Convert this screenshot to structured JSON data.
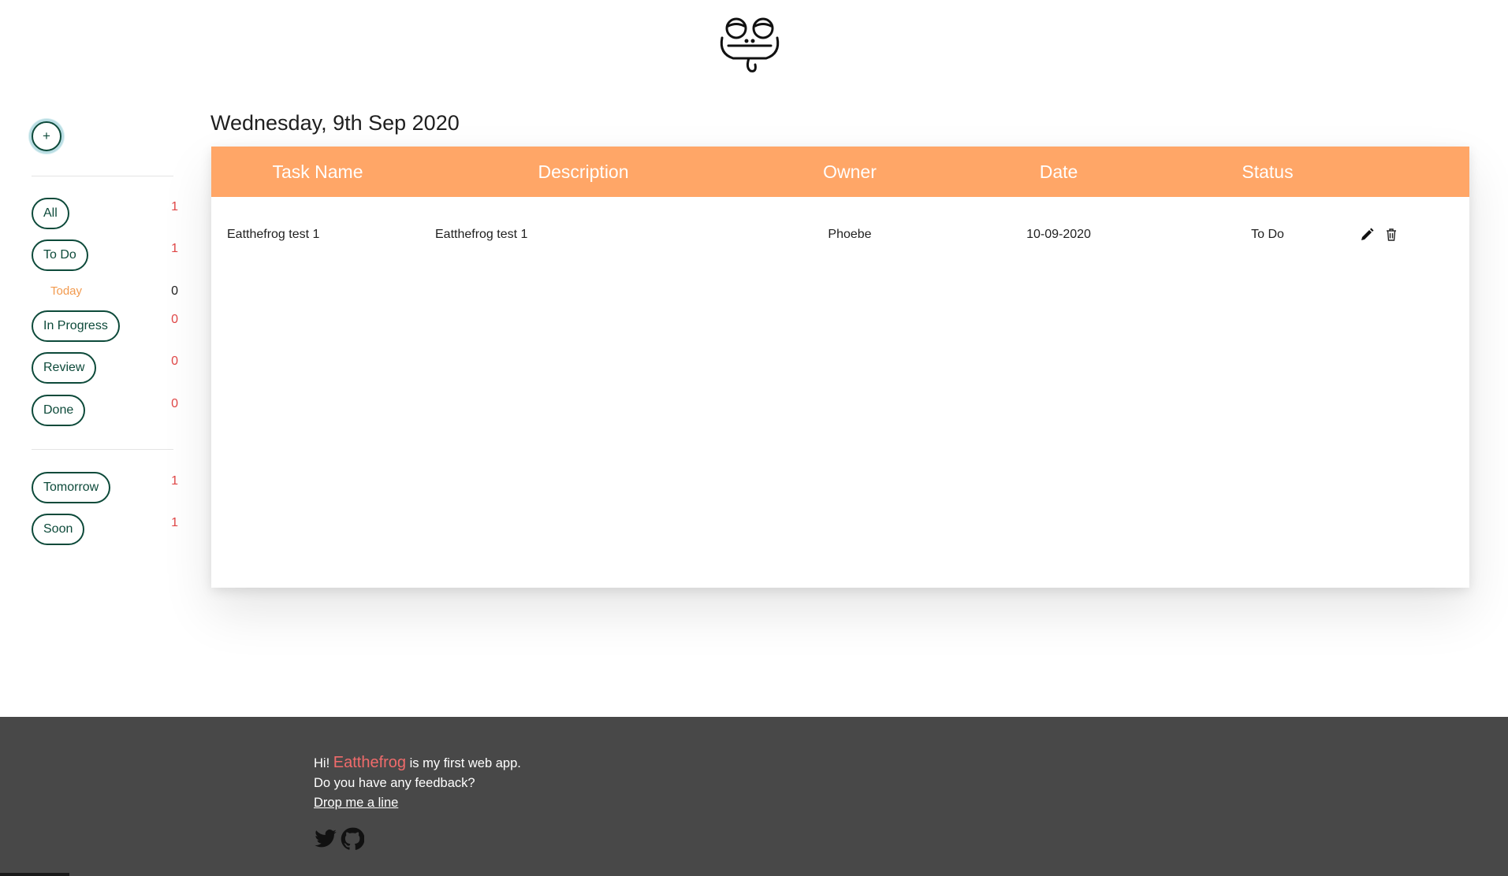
{
  "header": {
    "logo_icon": "frog-face-icon"
  },
  "sidebar": {
    "add_label": "+",
    "filters": [
      {
        "label": "All",
        "count": "1"
      },
      {
        "label": "To Do",
        "count": "1"
      },
      {
        "label": "Today",
        "count": "0"
      },
      {
        "label": "In Progress",
        "count": "0"
      },
      {
        "label": "Review",
        "count": "0"
      },
      {
        "label": "Done",
        "count": "0"
      }
    ],
    "timeframes": [
      {
        "label": "Tomorrow",
        "count": "1"
      },
      {
        "label": "Soon",
        "count": "1"
      }
    ]
  },
  "main": {
    "date_title": "Wednesday, 9th Sep 2020",
    "columns": [
      "Task Name",
      "Description",
      "Owner",
      "Date",
      "Status"
    ],
    "rows": [
      {
        "name": "Eatthefrog test 1",
        "description": "Eatthefrog test 1",
        "owner": "Phoebe",
        "date": "10-09-2020",
        "status": "To Do"
      }
    ],
    "row_actions": [
      "pencil-icon",
      "trash-icon"
    ]
  },
  "footer": {
    "greeting": "Hi! ",
    "brand": "Eatthefrog",
    "line1_rest": " is my first web app.",
    "line2": "Do you have any feedback?",
    "link": "Drop me a line",
    "social_icons": [
      "twitter-icon",
      "github-icon"
    ]
  },
  "colors": {
    "accent_orange": "#ffa667",
    "pill_green": "#0d4a3a",
    "count_red": "#e04646",
    "today_orange": "#f29a4e",
    "footer_bg": "#484848",
    "brand_red": "#f06b6b"
  }
}
